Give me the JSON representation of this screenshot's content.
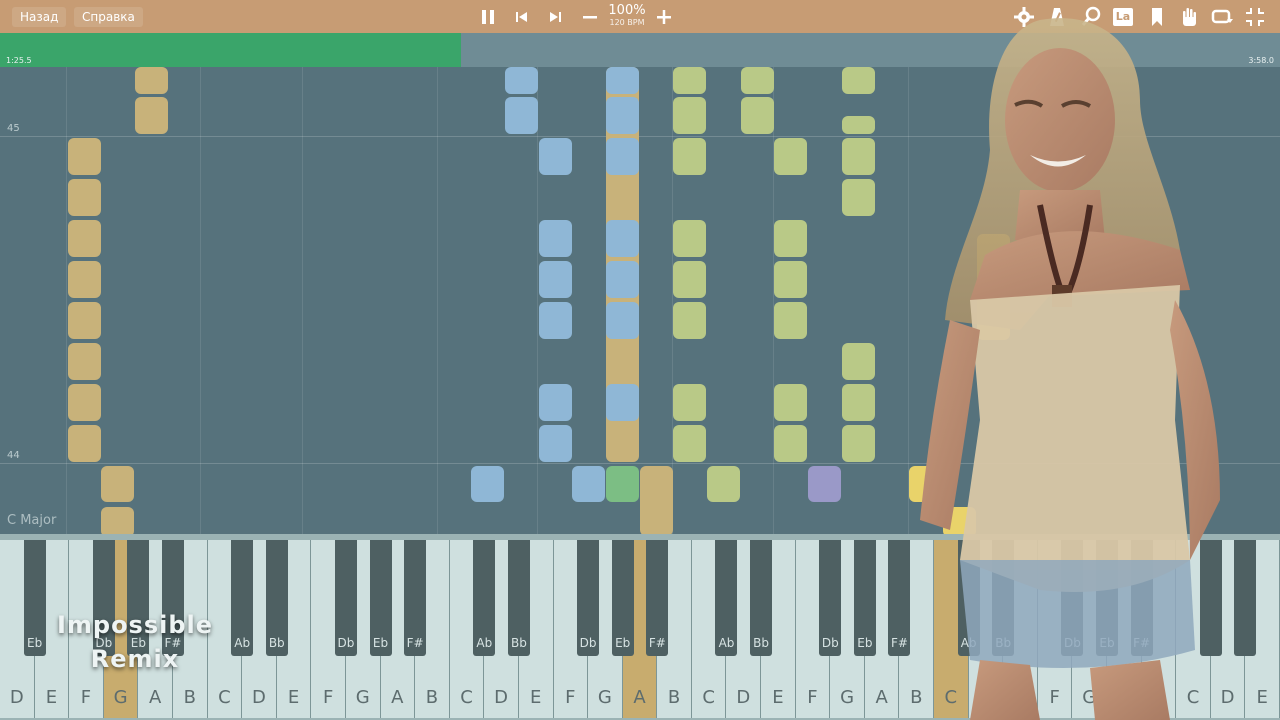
{
  "topbar": {
    "back_label": "Назад",
    "help_label": "Справка",
    "zoom": "100%",
    "bpm": "120 BPM",
    "icons": [
      "pause-icon",
      "previous-icon",
      "next-icon",
      "minus-icon",
      "plus-icon",
      "settings-icon",
      "metronome-icon",
      "search-icon",
      "note-name-icon",
      "bookmark-icon",
      "hand-icon",
      "loop-icon",
      "collapse-icon"
    ],
    "note_name_label": "La"
  },
  "timeline": {
    "current_time": "1:25.5",
    "total_time": "3:58.0",
    "progress": 0.36
  },
  "roll": {
    "measures": [
      "45",
      "44"
    ],
    "key_signature": "C Major"
  },
  "keyboard": {
    "white_keys": [
      "D",
      "E",
      "F",
      "G",
      "A",
      "B",
      "C",
      "D",
      "E",
      "F",
      "G",
      "A",
      "B",
      "C",
      "D",
      "E",
      "F",
      "G",
      "A",
      "B",
      "C",
      "D",
      "E",
      "F",
      "G",
      "A",
      "B",
      "C",
      "D",
      "E",
      "F",
      "G",
      "A",
      "B",
      "C",
      "D",
      "E"
    ],
    "black_key_labels": [
      "Eb",
      "Db",
      "Eb",
      "F#",
      "Ab",
      "Bb",
      "Db",
      "Eb",
      "F#",
      "Ab",
      "Bb",
      "Db",
      "Eb",
      "F#",
      "Ab",
      "Bb",
      "Db",
      "Eb",
      "F#",
      "Ab",
      "Bb",
      "Db",
      "Eb",
      "F#"
    ],
    "active_white_keys": [
      "G",
      "B",
      "D"
    ]
  },
  "overlay_title": {
    "line1": "Impossible",
    "line2": "Remix"
  },
  "colors": {
    "topbar": "#c79c74",
    "progress": "#3aa56a",
    "roll_bg": "#56727c",
    "note_gold": "#c8b27a",
    "note_blue": "#8fb7d6",
    "note_lime": "#b9c987",
    "note_purple": "#9a99c8"
  }
}
